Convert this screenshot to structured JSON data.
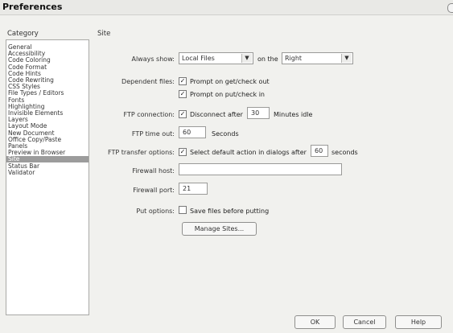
{
  "window": {
    "title": "Preferences"
  },
  "category": {
    "header": "Category",
    "items": [
      "General",
      "Accessibility",
      "Code Coloring",
      "Code Format",
      "Code Hints",
      "Code Rewriting",
      "CSS Styles",
      "File Types / Editors",
      "Fonts",
      "Highlighting",
      "Invisible Elements",
      "Layers",
      "Layout Mode",
      "New Document",
      "Office Copy/Paste",
      "Panels",
      "Preview in Browser",
      "Site",
      "Status Bar",
      "Validator"
    ],
    "selected": "Site"
  },
  "site": {
    "header": "Site",
    "always_show": {
      "label": "Always show:",
      "value": "Local Files",
      "on_the_label": "on the",
      "side_value": "Right"
    },
    "dependent_files": {
      "label": "Dependent files:",
      "prompt_get_label": "Prompt on get/check out",
      "prompt_get_checked": true,
      "prompt_put_label": "Prompt on put/check in",
      "prompt_put_checked": true
    },
    "ftp_connection": {
      "label": "FTP connection:",
      "disconnect_label": "Disconnect after",
      "disconnect_checked": true,
      "minutes": "30",
      "minutes_suffix": "Minutes idle"
    },
    "ftp_time_out": {
      "label": "FTP time out:",
      "value": "60",
      "suffix": "Seconds"
    },
    "ftp_transfer": {
      "label": "FTP transfer options:",
      "select_default_label": "Select default action in dialogs after",
      "select_default_checked": true,
      "seconds_value": "60",
      "seconds_suffix": "seconds"
    },
    "firewall_host": {
      "label": "Firewall host:",
      "value": ""
    },
    "firewall_port": {
      "label": "Firewall port:",
      "value": "21"
    },
    "put_options": {
      "label": "Put options:",
      "save_label": "Save files before putting",
      "save_checked": false
    },
    "manage_sites_label": "Manage Sites..."
  },
  "buttons": {
    "ok": "OK",
    "cancel": "Cancel",
    "help": "Help"
  },
  "icons": {
    "checked": "check-mark",
    "dropdown": "chevron-down"
  }
}
